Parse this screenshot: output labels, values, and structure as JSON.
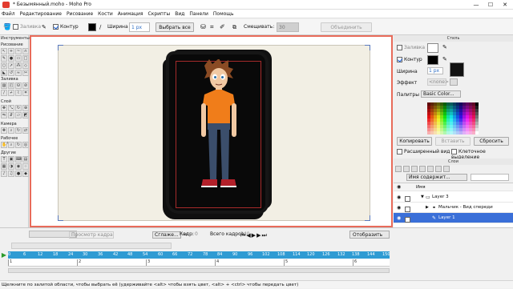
{
  "window": {
    "title": "* Безымянный.moho - Moho Pro",
    "minimize": "—",
    "maximize": "☐",
    "close": "✕"
  },
  "menu": [
    "Файл",
    "Редактирование",
    "Рисование",
    "Кости",
    "Анимация",
    "Скрипты",
    "Вид",
    "Панели",
    "Помощь"
  ],
  "toolbar": {
    "fill_label": "Заливка",
    "stroke_label": "Контур",
    "width_label": "Ширина",
    "width_value": "1 px",
    "select_all": "Выбрать все",
    "smooth_label": "Смещивать:",
    "smooth_value": "30",
    "merge": "Объединить"
  },
  "tools": {
    "header": "Инструменты",
    "draw": "Рисование",
    "fill": "Заливка",
    "layer": "Слой",
    "camera": "Камера",
    "workspace": "Рабочее поле",
    "other": "Другие"
  },
  "style": {
    "header": "Стиль",
    "fill_label": "Заливка",
    "stroke_label": "Контур",
    "width_label": "Ширина",
    "width_value": "1 px",
    "effect_label": "Эффект",
    "effect_value": "<none>",
    "palette_label": "Палитры",
    "palette_value": "Basic Color...",
    "copy": "Копировать",
    "paste": "Вставить",
    "reset": "Сбросить",
    "advanced": "Расширенный вид",
    "cell_select": "Клеточное выделение"
  },
  "layers": {
    "header": "Слои",
    "filter_value": "Имя содержит...",
    "name_col": "Имя",
    "rows": [
      "Layer 3",
      "Мальчик - Вид спереди",
      "Layer 1"
    ]
  },
  "timeline": {
    "play_range": "Просмотр кадра",
    "smooth": "Сглаже...",
    "frame_label": "Кадр:",
    "frame_value": "0",
    "total_label": "Всего кадров:",
    "total_value": "240",
    "display": "Отобразить",
    "ticks": [
      "0",
      "6",
      "12",
      "18",
      "24",
      "30",
      "36",
      "42",
      "48",
      "54",
      "60",
      "66",
      "72",
      "78",
      "84",
      "90",
      "96",
      "102",
      "108",
      "114",
      "120",
      "126",
      "132",
      "138",
      "144",
      "150"
    ],
    "marks": [
      "1",
      "2",
      "3",
      "4",
      "5",
      "6"
    ]
  },
  "status": "Щелкните по залитой области, чтобы выбрать её (удерживайте <alt> чтобы взять цвет, <alt> + <ctrl> чтобы передать цвет)",
  "colors": {
    "accent": "#e86b5a",
    "selection": "#3a6fd8",
    "ruler": "#2f9bd3",
    "shirt": "#f07d1a",
    "jeans": "#3b4e6b",
    "skin": "#f1c9a3",
    "hair": "#8a4b24",
    "shoes": "#b3202a"
  }
}
